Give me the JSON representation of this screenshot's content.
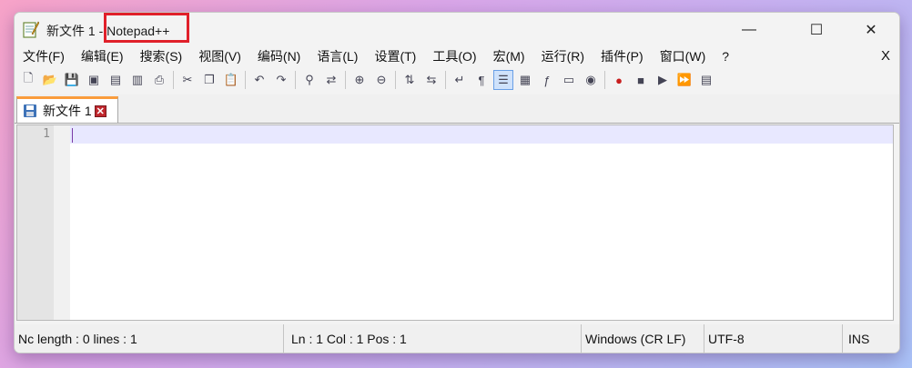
{
  "window": {
    "title_doc": "新文件 1 -",
    "title_app": "Notepad++",
    "controls": {
      "minimize": "—",
      "maximize": "☐",
      "close": "✕"
    }
  },
  "menu": {
    "items": [
      "文件(F)",
      "编辑(E)",
      "搜索(S)",
      "视图(V)",
      "编码(N)",
      "语言(L)",
      "设置(T)",
      "工具(O)",
      "宏(M)",
      "运行(R)",
      "插件(P)",
      "窗口(W)",
      "?"
    ],
    "close_label": "X"
  },
  "toolbar": {
    "groups": [
      [
        "new-file-icon",
        "open-file-icon",
        "save-icon",
        "save-all-icon",
        "close-icon",
        "close-all-icon",
        "print-icon"
      ],
      [
        "cut-icon",
        "copy-icon",
        "paste-icon"
      ],
      [
        "undo-icon",
        "redo-icon"
      ],
      [
        "find-icon",
        "replace-icon"
      ],
      [
        "zoom-in-icon",
        "zoom-out-icon"
      ],
      [
        "sync-vertical-icon",
        "sync-horizontal-icon"
      ],
      [
        "word-wrap-icon",
        "show-all-chars-icon",
        "indent-guide-icon",
        "doc-map-icon",
        "function-list-icon",
        "folder-workspace-icon",
        "monitoring-icon"
      ],
      [
        "record-macro-icon",
        "stop-macro-icon",
        "play-macro-icon",
        "run-macro-multiple-icon",
        "save-macro-icon"
      ]
    ],
    "glyphs": {
      "new-file-icon": "🗋",
      "open-file-icon": "📂",
      "save-icon": "💾",
      "save-all-icon": "▣",
      "close-icon": "▤",
      "close-all-icon": "▥",
      "print-icon": "⎙",
      "cut-icon": "✂",
      "copy-icon": "❐",
      "paste-icon": "📋",
      "undo-icon": "↶",
      "redo-icon": "↷",
      "find-icon": "⚲",
      "replace-icon": "⇄",
      "zoom-in-icon": "⊕",
      "zoom-out-icon": "⊖",
      "sync-vertical-icon": "⇅",
      "sync-horizontal-icon": "⇆",
      "word-wrap-icon": "↵",
      "show-all-chars-icon": "¶",
      "indent-guide-icon": "☰",
      "doc-map-icon": "▦",
      "function-list-icon": "ƒ",
      "folder-workspace-icon": "▭",
      "monitoring-icon": "◉",
      "record-macro-icon": "●",
      "stop-macro-icon": "■",
      "play-macro-icon": "▶",
      "run-macro-multiple-icon": "⏩",
      "save-macro-icon": "▤"
    },
    "active": "indent-guide-icon"
  },
  "tab": {
    "label": "新文件 1",
    "close": "✕"
  },
  "editor": {
    "line_numbers": [
      "1"
    ]
  },
  "status": {
    "length": "Nc length : 0    lines : 1",
    "position": "Ln : 1    Col : 1    Pos : 1",
    "eol": "Windows (CR LF)",
    "encoding": "UTF-8",
    "mode": "INS"
  },
  "colors": {
    "tab_accent": "#fa9c3c",
    "highlight_box": "#e0202a",
    "current_line": "#e8e8ff"
  }
}
